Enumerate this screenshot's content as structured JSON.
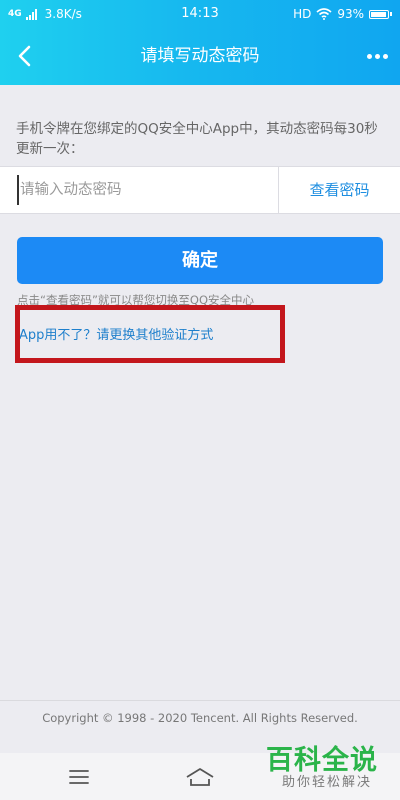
{
  "status_bar": {
    "network": "4G",
    "speed": "3.8K/s",
    "time": "14:13",
    "hd_label": "HD",
    "battery": "93%"
  },
  "header": {
    "title": "请填写动态密码",
    "back_icon": "chevron-left-icon",
    "more_icon": "more-dots-icon",
    "gradient_start": "#1fd0ef",
    "gradient_end": "#10a6f0"
  },
  "form": {
    "hint": "手机令牌在您绑定的QQ安全中心App中，其动态密码每30秒更新一次：",
    "input_placeholder": "请输入动态密码",
    "input_value": "",
    "view_code_label": "查看密码",
    "confirm_label": "确定",
    "tip": "点击“查看密码”就可以帮您切换至QQ安全中心",
    "alt_link": "App用不了？请更换其他验证方式"
  },
  "colors": {
    "primary_button": "#1c8af5",
    "link": "#1e7fcc",
    "highlight_border": "#c3161c"
  },
  "footer": {
    "copyright": "Copyright © 1998 - 2020 Tencent. All Rights Reserved."
  },
  "bottom_nav": {
    "menu_icon": "menu-icon",
    "home_icon": "home-icon"
  },
  "watermark": {
    "title": "百科全说",
    "subtitle": "助你轻松解决"
  }
}
